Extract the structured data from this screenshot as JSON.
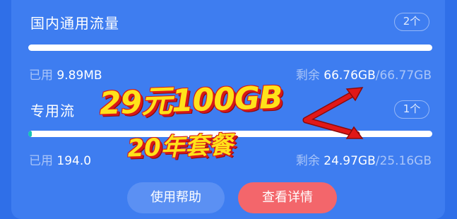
{
  "sections": [
    {
      "title": "国内通用流量",
      "count": "2个",
      "used_label": "已用",
      "used_value": "9.89MB",
      "remain_label": "剩余",
      "remain_value": "66.76GB",
      "total_value": "/66.77GB",
      "used_fraction": 0.0
    },
    {
      "title": "专用流",
      "count": "1个",
      "used_label": "已用",
      "used_value": "194.0",
      "remain_label": "剩余",
      "remain_value": "24.97GB",
      "total_value": "/25.16GB",
      "used_fraction": 0.008
    }
  ],
  "buttons": {
    "help": "使用帮助",
    "details": "查看详情"
  },
  "overlay": {
    "line1": "29元100GB",
    "line2": "20年套餐"
  },
  "colors": {
    "background": "#2f6fe8",
    "card": "#3e7df0",
    "progress": "#14c3b5",
    "promo_text": "#ffe21a",
    "promo_outline": "#d81818",
    "detail_button": "#f3666b"
  }
}
